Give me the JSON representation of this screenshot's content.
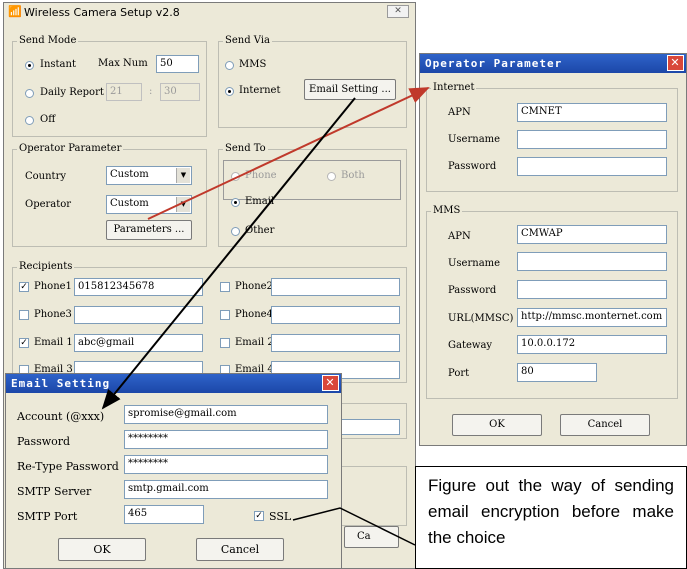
{
  "main": {
    "title": "Wireless Camera Setup  v2.8",
    "close": "✕",
    "send_mode": {
      "title": "Send Mode",
      "instant": "Instant",
      "max_num_label": "Max Num",
      "max_num": "50",
      "daily": "Daily Report",
      "daily_h": "21",
      "daily_sep": ":",
      "daily_m": "30",
      "off": "Off"
    },
    "send_via": {
      "title": "Send Via",
      "mms": "MMS",
      "internet": "Internet",
      "email_setting": "Email Setting ..."
    },
    "operator_param": {
      "title": "Operator Parameter",
      "country_label": "Country",
      "country": "Custom",
      "operator_label": "Operator",
      "operator": "Custom",
      "parameters_btn": "Parameters ..."
    },
    "send_to": {
      "title": "Send To",
      "phone": "Phone",
      "both": "Both",
      "email": "Email",
      "other": "Other"
    },
    "recipients": {
      "title": "Recipients",
      "phone1": "Phone1",
      "phone1_val": "015812345678",
      "phone2": "Phone2",
      "phone3": "Phone3",
      "phone4": "Phone4",
      "email1": "Email 1",
      "email1_val": "abc@gmail",
      "email2": "Email 2",
      "email3": "Email 3",
      "email4": "Email 4"
    },
    "cancel_partial": "Ca"
  },
  "operator_window": {
    "title": "Operator Parameter",
    "internet": {
      "title": "Internet",
      "apn_label": "APN",
      "apn": "CMNET",
      "username_label": "Username",
      "password_label": "Password"
    },
    "mms": {
      "title": "MMS",
      "apn_label": "APN",
      "apn": "CMWAP",
      "username_label": "Username",
      "password_label": "Password",
      "url_label": "URL(MMSC)",
      "url": "http://mmsc.monternet.com",
      "gateway_label": "Gateway",
      "gateway": "10.0.0.172",
      "port_label": "Port",
      "port": "80"
    },
    "ok": "OK",
    "cancel": "Cancel"
  },
  "email_window": {
    "title": "Email Setting",
    "account_label": "Account (@xxx)",
    "account": "spromise@gmail.com",
    "password_label": "Password",
    "password": "********",
    "retype_label": "Re-Type Password",
    "retype": "********",
    "smtp_server_label": "SMTP Server",
    "smtp_server": "smtp.gmail.com",
    "smtp_port_label": "SMTP Port",
    "smtp_port": "465",
    "ssl_label": "SSL",
    "ok": "OK",
    "cancel": "Cancel"
  },
  "callout": {
    "text": "Figure out the way of sending email encryption before make the choice"
  },
  "colors": {
    "title_blue": "#1c47a8",
    "arrow_red": "#c0392b",
    "window_bg": "#ece9d8"
  }
}
